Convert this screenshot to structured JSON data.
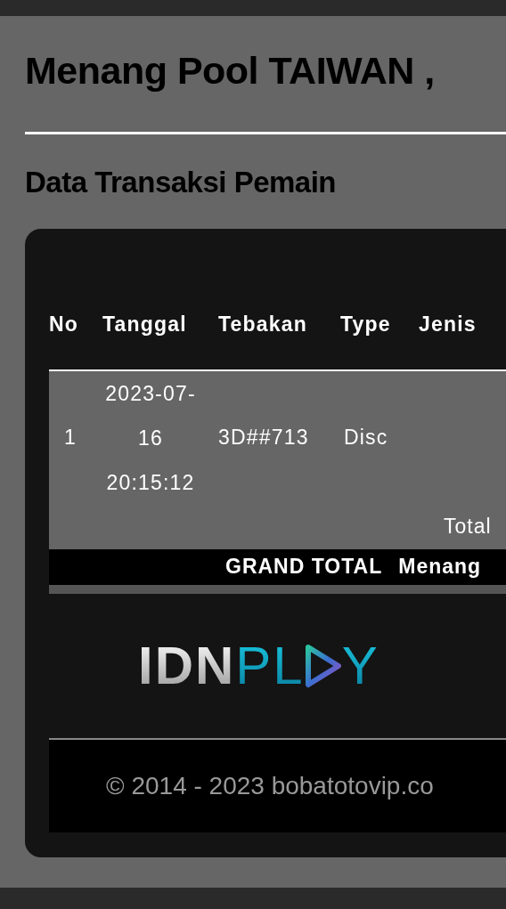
{
  "title": "Menang Pool TAIWAN ,",
  "subtitle": "Data Transaksi Pemain",
  "table": {
    "columns": [
      "No",
      "Tanggal",
      "Tebakan",
      "Type",
      "Jenis"
    ],
    "rows": [
      {
        "no": "1",
        "date_lines": [
          "2023-07-",
          "16",
          "20:15:12"
        ],
        "tebakan": "3D##713",
        "type": "Disc"
      }
    ],
    "total_label": "Total",
    "grand_total": {
      "label": "GRAND TOTAL",
      "column_2": "Menang"
    }
  },
  "logo": {
    "part_1": "IDN",
    "part_2": "PL",
    "part_3": "Y"
  },
  "footer": "© 2014 - 2023 bobatotovip.co"
}
